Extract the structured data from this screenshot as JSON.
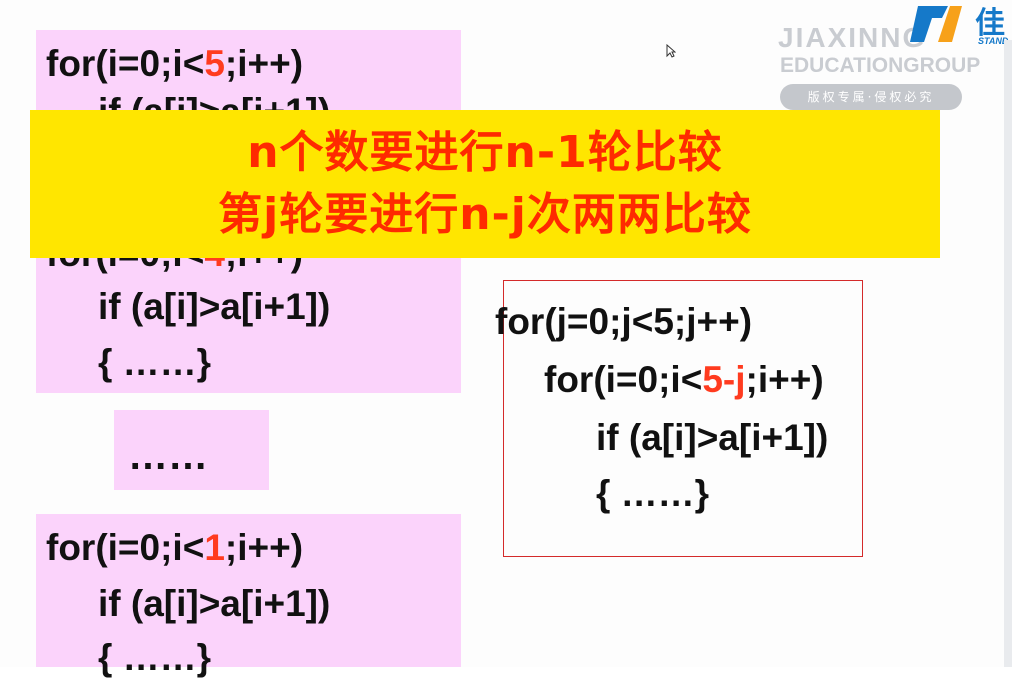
{
  "banner": {
    "line1": "n个数要进行n-1轮比较",
    "line2": "第j轮要进行n-j次两两比较"
  },
  "watermark": {
    "brand": "JIAXINNG",
    "group": "EDUCATIONGROUP",
    "notice": "版权专属·侵权必究"
  },
  "logo": {
    "text": "佳",
    "sub": "STAND"
  },
  "code_blocks": {
    "first": {
      "loop_pre": "for(i=0;i<",
      "loop_bound": "5",
      "loop_post": ";i++)",
      "if_line": "if (a[i]>a[i+1])"
    },
    "second": {
      "loop_pre": "for(i=0;i<",
      "loop_bound": "4",
      "loop_post": ";i++)",
      "if_line": "if (a[i]>a[i+1])",
      "body_line": "{ ……}"
    },
    "ellipsis": "……",
    "last": {
      "loop_pre": "for(i=0;i<",
      "loop_bound": "1",
      "loop_post": ";i++)",
      "if_line": "if (a[i]>a[i+1])",
      "body_line": "{ ……}"
    }
  },
  "general_code": {
    "outer_loop": "for(j=0;j<5;j++)",
    "inner_pre": "for(i=0;i<",
    "inner_bound": "5-j",
    "inner_post": ";i++)",
    "if_line": "if (a[i]>a[i+1])",
    "body_line": "{ ……}"
  },
  "colors": {
    "highlight_red": "#ff3b1f",
    "banner_yellow": "#ffe600",
    "block_pink": "#fbd3fb",
    "logo_blue": "#1579c9"
  }
}
